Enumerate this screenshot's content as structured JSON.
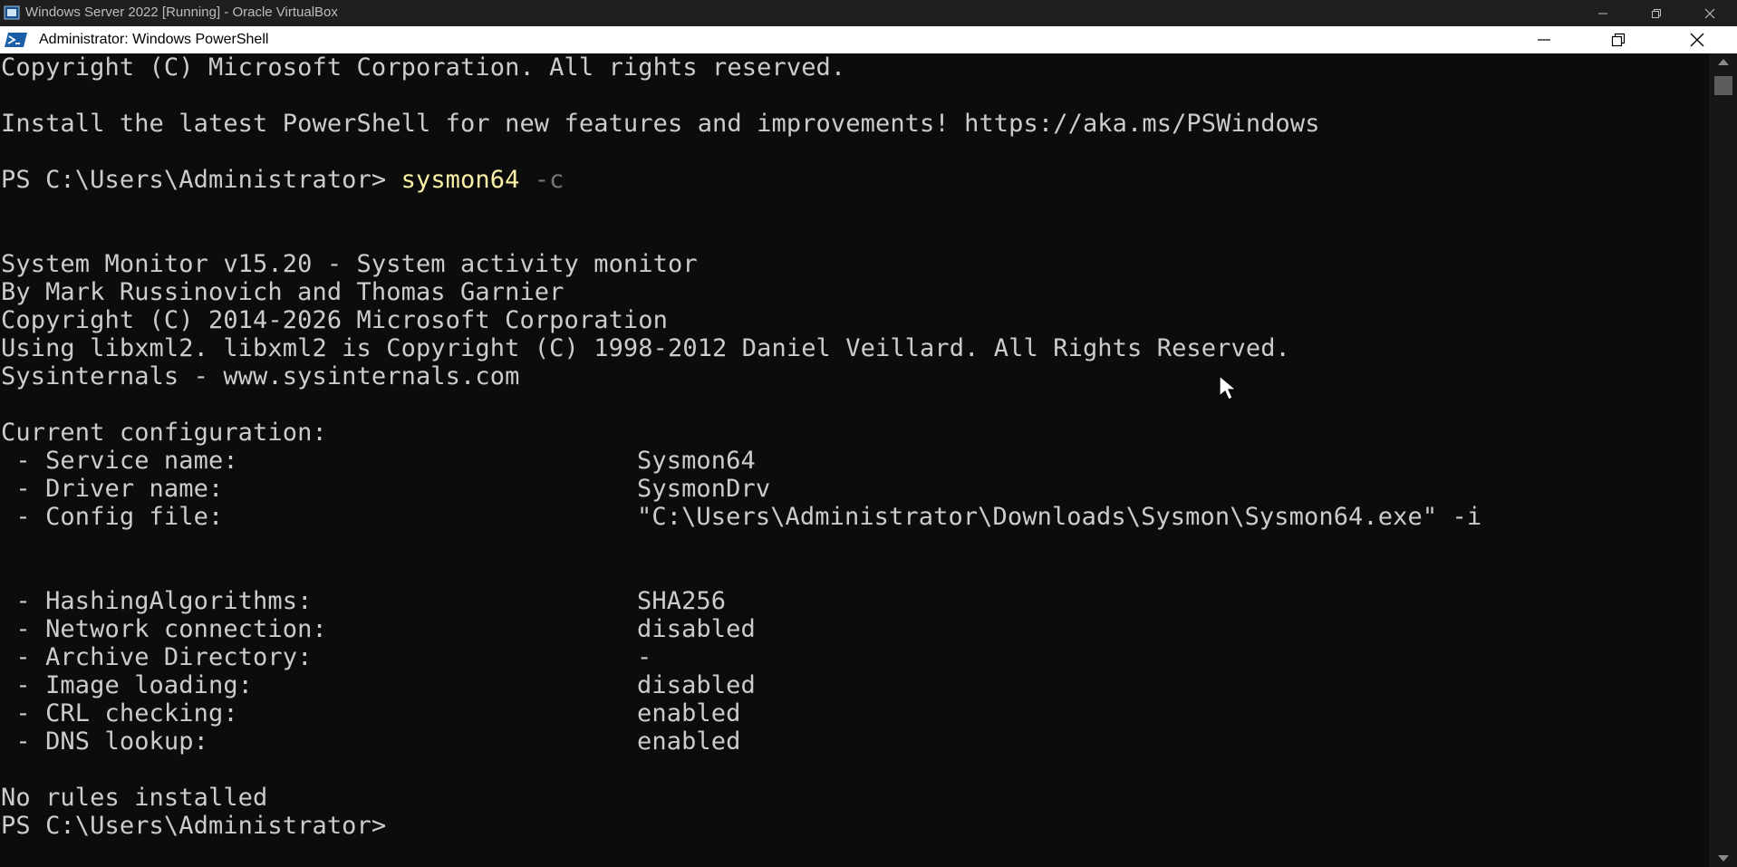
{
  "vbox": {
    "title": "Windows Server 2022 [Running] - Oracle VirtualBox"
  },
  "window": {
    "title": "Administrator: Windows PowerShell"
  },
  "console": {
    "lines": {
      "l0": "Copyright (C) Microsoft Corporation. All rights reserved.",
      "l1": "Install the latest PowerShell for new features and improvements! https://aka.ms/PSWindows",
      "l2_prompt": "PS C:\\Users\\Administrator> ",
      "l2_cmd": "sysmon64",
      "l2_param": " -c",
      "l3": "System Monitor v15.20 - System activity monitor",
      "l4": "By Mark Russinovich and Thomas Garnier",
      "l5": "Copyright (C) 2014-2026 Microsoft Corporation",
      "l6": "Using libxml2. libxml2 is Copyright (C) 1998-2012 Daniel Veillard. All Rights Reserved.",
      "l7": "Sysinternals - www.sysinternals.com",
      "l8": "Current configuration:",
      "l16": "No rules installed",
      "l17": "PS C:\\Users\\Administrator>"
    },
    "config": [
      {
        "label": " - Service name:",
        "value": "Sysmon64"
      },
      {
        "label": " - Driver name:",
        "value": "SysmonDrv"
      },
      {
        "label": " - Config file:",
        "value": "\"C:\\Users\\Administrator\\Downloads\\Sysmon\\Sysmon64.exe\" -i"
      },
      {
        "label": " - HashingAlgorithms:",
        "value": "SHA256"
      },
      {
        "label": " - Network connection:",
        "value": "disabled"
      },
      {
        "label": " - Archive Directory:",
        "value": "-"
      },
      {
        "label": " - Image loading:",
        "value": "disabled"
      },
      {
        "label": " - CRL checking:",
        "value": "enabled"
      },
      {
        "label": " - DNS lookup:",
        "value": "enabled"
      }
    ]
  },
  "colors": {
    "background": "#0c0c0c",
    "text": "#cccccc",
    "command": "#f9f1a5",
    "parameter": "#767676"
  },
  "icons": {
    "vbox": "virtualbox-icon",
    "powershell": "powershell-icon",
    "minimize": "minimize-icon",
    "restore": "restore-icon",
    "close": "close-icon",
    "cursor": "mouse-pointer-icon"
  }
}
